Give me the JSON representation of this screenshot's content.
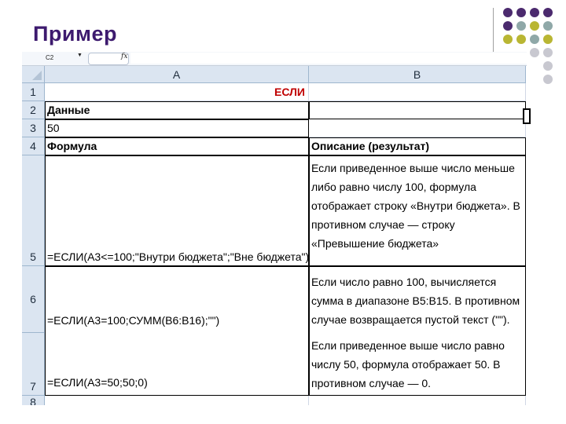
{
  "slide": {
    "title": "Пример"
  },
  "formula_bar": {
    "name_box": "C2",
    "fx_label": "fx"
  },
  "columns": [
    "A",
    "B"
  ],
  "rows": [
    "1",
    "2",
    "3",
    "4",
    "5",
    "6",
    "7",
    "8"
  ],
  "cells": {
    "a1": "ЕСЛИ",
    "a2": "Данные",
    "a3": "50",
    "a4": "Формула",
    "b4": "Описание (результат)",
    "a5": "=ЕСЛИ(A3<=100;\"Внутри бюджета\";\"Вне бюджета\")",
    "b5": "Если приведенное выше число меньше либо равно числу 100, формула отображает строку «Внутри бюджета». В противном случае — строку «Превышение бюджета»",
    "a6": "=ЕСЛИ(A3=100;СУММ(B6:B16);\"\")",
    "b6": "Если число равно 100, вычисляется сумма в диапазоне B5:B15. В противном случае возвращается пустой текст (\"\").",
    "a7": "=ЕСЛИ(A3=50;50;0)",
    "b7": "Если приведенное выше число равно числу 50, формула отображает 50. В противном случае — 0."
  },
  "colors": {
    "title": "#3d1a6e",
    "header_bg": "#dbe5f1",
    "esli_red": "#c00000",
    "dot_purple": "#4b2a6e",
    "dot_olive": "#b9b633",
    "dot_teal": "#8fa8a8",
    "dot_gray": "#c8c8d0"
  }
}
